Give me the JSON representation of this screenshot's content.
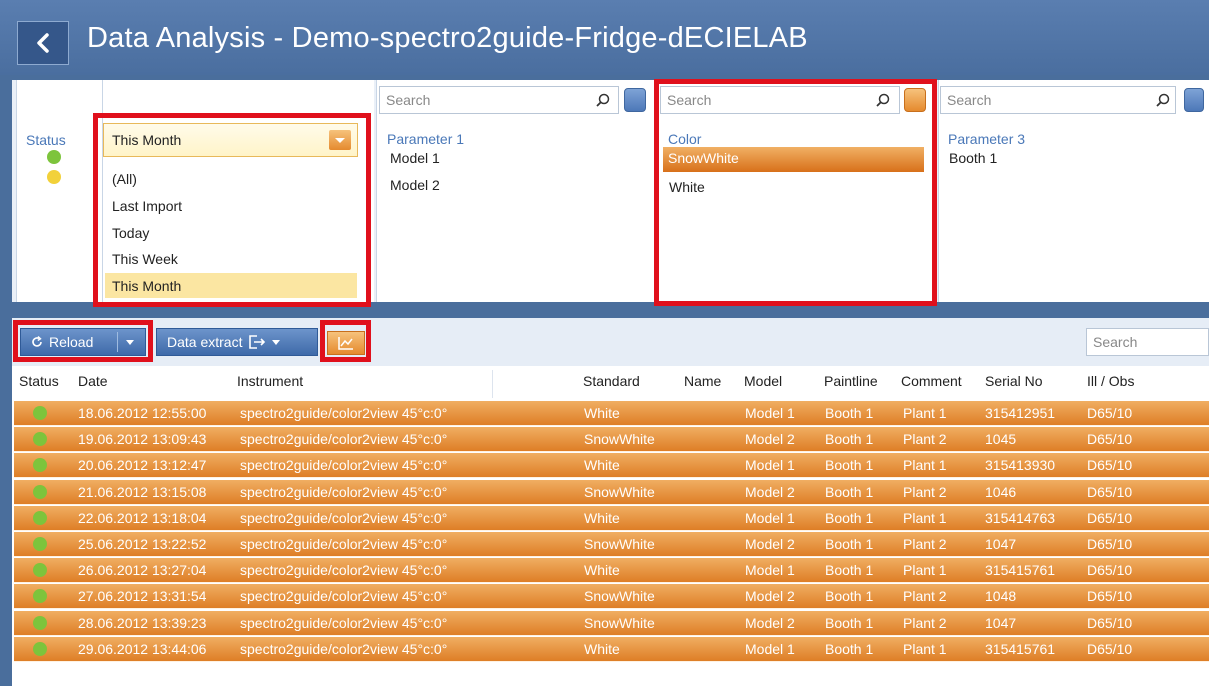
{
  "window": {
    "title": "Data Analysis - Demo-spectro2guide-Fridge-dECIELAB"
  },
  "filters": {
    "status": {
      "header": "Status"
    },
    "date": {
      "selected": "This Month",
      "options": [
        "(All)",
        "Last Import",
        "Today",
        "This Week",
        "This Month"
      ]
    },
    "param1": {
      "search_placeholder": "Search",
      "header": "Parameter 1",
      "items": [
        "Model 1",
        "Model 2"
      ]
    },
    "color": {
      "search_placeholder": "Search",
      "header": "Color",
      "items": [
        "SnowWhite",
        "White"
      ],
      "selected": "SnowWhite"
    },
    "param3": {
      "search_placeholder": "Search",
      "header": "Parameter 3",
      "items": [
        "Booth 1"
      ]
    }
  },
  "toolbar": {
    "reload_label": "Reload",
    "extract_label": "Data extract",
    "search_placeholder": "Search"
  },
  "table": {
    "columns": [
      "Status",
      "Date",
      "Instrument",
      "Standard",
      "Name",
      "Model",
      "Paintline",
      "Comment",
      "Serial No",
      "Ill / Obs"
    ],
    "rows": [
      {
        "date": "18.06.2012 12:55:00",
        "instrument": "spectro2guide/color2view 45°c:0°",
        "standard": "White",
        "model": "Model 1",
        "paintline": "Booth 1",
        "comment": "Plant 1",
        "serial": "315412951",
        "obs": "D65/10"
      },
      {
        "date": "19.06.2012 13:09:43",
        "instrument": "spectro2guide/color2view 45°c:0°",
        "standard": "SnowWhite",
        "model": "Model 2",
        "paintline": "Booth 1",
        "comment": "Plant 2",
        "serial": "1045",
        "obs": "D65/10"
      },
      {
        "date": "20.06.2012 13:12:47",
        "instrument": "spectro2guide/color2view 45°c:0°",
        "standard": "White",
        "model": "Model 1",
        "paintline": "Booth 1",
        "comment": "Plant 1",
        "serial": "315413930",
        "obs": "D65/10"
      },
      {
        "date": "21.06.2012 13:15:08",
        "instrument": "spectro2guide/color2view 45°c:0°",
        "standard": "SnowWhite",
        "model": "Model 2",
        "paintline": "Booth 1",
        "comment": "Plant 2",
        "serial": "1046",
        "obs": "D65/10"
      },
      {
        "date": "22.06.2012 13:18:04",
        "instrument": "spectro2guide/color2view 45°c:0°",
        "standard": "White",
        "model": "Model 1",
        "paintline": "Booth 1",
        "comment": "Plant 1",
        "serial": "315414763",
        "obs": "D65/10"
      },
      {
        "date": "25.06.2012 13:22:52",
        "instrument": "spectro2guide/color2view 45°c:0°",
        "standard": "SnowWhite",
        "model": "Model 2",
        "paintline": "Booth 1",
        "comment": "Plant 2",
        "serial": "1047",
        "obs": "D65/10"
      },
      {
        "date": "26.06.2012 13:27:04",
        "instrument": "spectro2guide/color2view 45°c:0°",
        "standard": "White",
        "model": "Model 1",
        "paintline": "Booth 1",
        "comment": "Plant 1",
        "serial": "315415761",
        "obs": "D65/10"
      },
      {
        "date": "27.06.2012 13:31:54",
        "instrument": "spectro2guide/color2view 45°c:0°",
        "standard": "SnowWhite",
        "model": "Model 2",
        "paintline": "Booth 1",
        "comment": "Plant 2",
        "serial": "1048",
        "obs": "D65/10"
      },
      {
        "date": "28.06.2012 13:39:23",
        "instrument": "spectro2guide/color2view 45°c:0°",
        "standard": "SnowWhite",
        "model": "Model 2",
        "paintline": "Booth 1",
        "comment": "Plant 2",
        "serial": "1047",
        "obs": "D65/10"
      },
      {
        "date": "29.06.2012 13:44:06",
        "instrument": "spectro2guide/color2view 45°c:0°",
        "standard": "White",
        "model": "Model 1",
        "paintline": "Booth 1",
        "comment": "Plant 1",
        "serial": "315415761",
        "obs": "D65/10"
      }
    ]
  },
  "colors": {
    "titlebar": "#4a6e9f",
    "row_orange": "#e88f3a",
    "status_green": "#7dc43c",
    "status_yellow": "#f2d13a",
    "highlight_red": "#e0101c"
  }
}
